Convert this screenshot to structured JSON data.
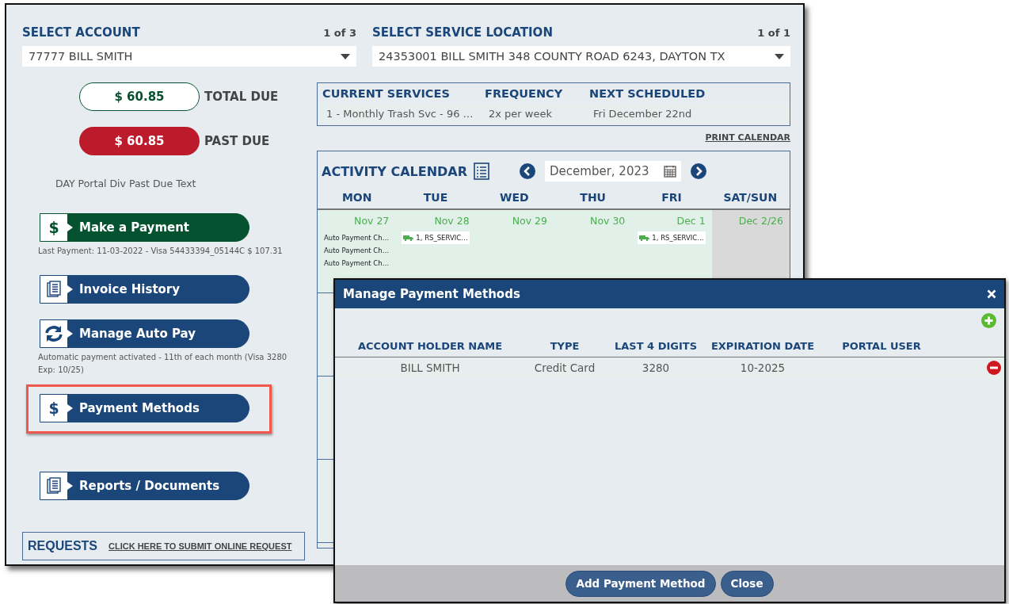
{
  "account": {
    "label": "SELECT ACCOUNT",
    "count": "1 of 3",
    "value": "77777 BILL SMITH"
  },
  "location": {
    "label": "SELECT SERVICE LOCATION",
    "count": "1 of 1",
    "value": "24353001 BILL SMITH  348 COUNTY ROAD 6243, DAYTON TX"
  },
  "balances": [
    {
      "kind": "total",
      "amount": "$ 60.85",
      "label": "TOTAL DUE"
    },
    {
      "kind": "past",
      "amount": "$ 60.85",
      "label": "PAST DUE"
    }
  ],
  "past_due_text": "DAY Portal Div Past Due Text",
  "actions": [
    {
      "kind": "dollar",
      "symbol": "$",
      "label": "Make a Payment",
      "color": "#04522f",
      "highlighted": false,
      "note": "Last Payment: 11-03-2022 - Visa 54433394_05144C  $ 107.31"
    },
    {
      "kind": "document",
      "label": "Invoice History",
      "color": "#1b4679",
      "highlighted": false
    },
    {
      "kind": "refresh",
      "label": "Manage Auto Pay",
      "color": "#1b4679",
      "highlighted": false,
      "note": "Automatic payment activated - 11th of each month (Visa 3280 Exp: 10/25)"
    },
    {
      "kind": "dollar",
      "symbol": "$",
      "label": "Payment Methods",
      "color": "#1b4679",
      "highlighted": true
    },
    {
      "kind": "document",
      "label": "Reports / Documents",
      "color": "#1b4679",
      "highlighted": false
    }
  ],
  "requests": {
    "title": "REQUESTS",
    "link": "CLICK HERE TO SUBMIT ONLINE REQUEST"
  },
  "services": {
    "columns": [
      "CURRENT SERVICES",
      "FREQUENCY",
      "NEXT SCHEDULED"
    ],
    "row": [
      "1 - Monthly Trash Svc - 96 …",
      "2x per week",
      "Fri December 22nd"
    ]
  },
  "print_calendar": "PRINT CALENDAR",
  "calendar": {
    "title": "ACTIVITY CALENDAR",
    "month": "December, 2023",
    "days": [
      "MON",
      "TUE",
      "WED",
      "THU",
      "FRI",
      "SAT/SUN"
    ],
    "week": [
      {
        "date": "Nov 27",
        "weekend": false,
        "events": [
          {
            "kind": "note",
            "text": "Auto Payment Ch…"
          },
          {
            "kind": "note",
            "text": "Auto Payment Ch…"
          },
          {
            "kind": "note",
            "text": "Auto Payment Ch…"
          }
        ]
      },
      {
        "date": "Nov 28",
        "weekend": false,
        "events": [
          {
            "kind": "truck",
            "text": "1, RS_SERVIC…"
          }
        ]
      },
      {
        "date": "Nov 29",
        "weekend": false
      },
      {
        "date": "Nov 30",
        "weekend": false
      },
      {
        "date": "Dec 1",
        "weekend": false,
        "events": [
          {
            "kind": "truck",
            "text": "1, RS_SERVIC…"
          }
        ]
      },
      {
        "date": "Dec 2/26",
        "weekend": true
      }
    ]
  },
  "modal": {
    "title": "Manage Payment Methods",
    "columns": [
      "ACCOUNT HOLDER NAME",
      "TYPE",
      "LAST 4 DIGITS",
      "EXPIRATION DATE",
      "PORTAL USER"
    ],
    "rows": [
      [
        "BILL SMITH",
        "Credit Card",
        "3280",
        "10-2025"
      ]
    ],
    "buttons": [
      "Add Payment Method",
      "Close"
    ]
  }
}
